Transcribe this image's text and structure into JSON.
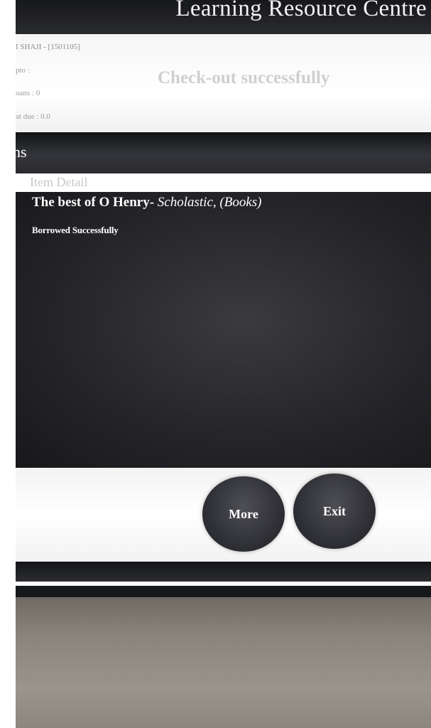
{
  "header": {
    "app_title": "Learning Resource Centre"
  },
  "patron": {
    "name_id": "I SHAJI - [1501105]",
    "valid_upto": "pto :",
    "loans": "oans : 0",
    "amount_due": "at due : 0.0"
  },
  "status": {
    "message": "Check-out successfully"
  },
  "section": {
    "title": "ns"
  },
  "table": {
    "column_header": "Item Detail",
    "rows": [
      {
        "title": "The best of O Henry-",
        "publisher": " Scholastic, (Books)",
        "status": "Borrowed Successfully"
      }
    ]
  },
  "buttons": {
    "more_label": "More",
    "exit_label": "Exit"
  },
  "colors": {
    "screen_dark": "#1c1c1f",
    "panel_light": "#ffffff",
    "button_dark": "#303136",
    "text_light": "#ffffff",
    "text_muted": "#cfcfcf"
  }
}
